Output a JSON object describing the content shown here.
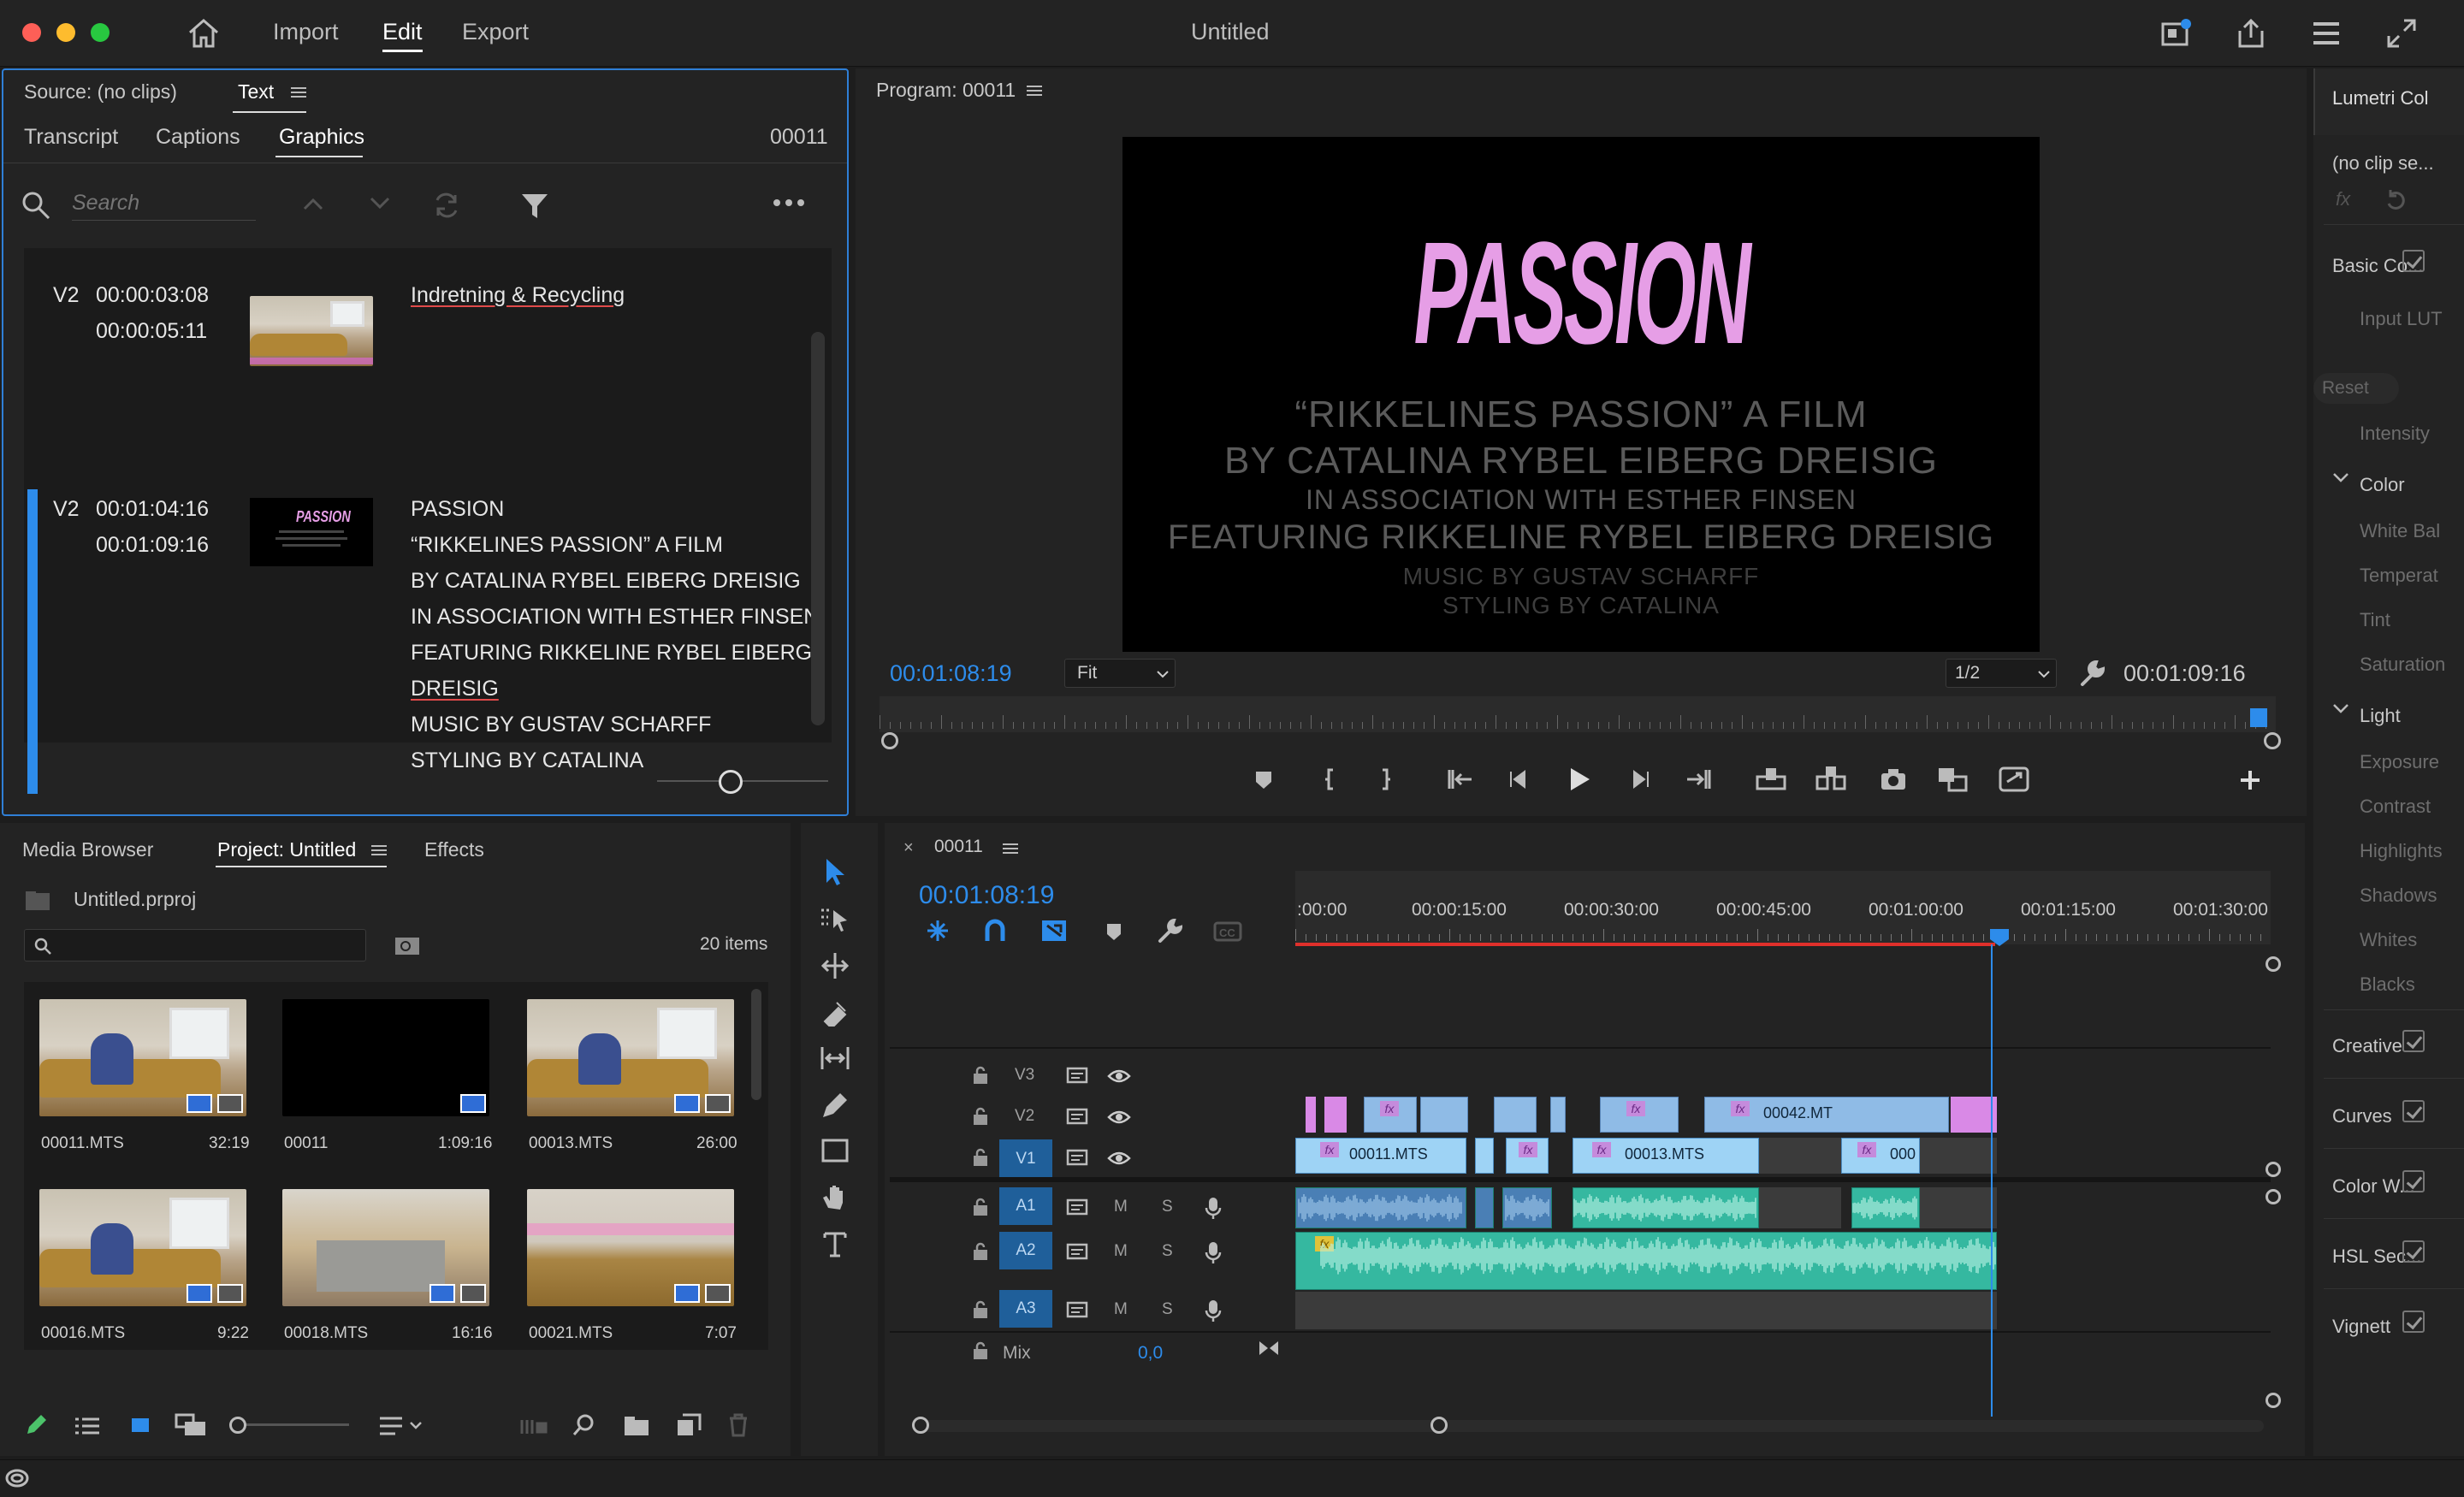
{
  "app": {
    "window_title": "Untitled",
    "menu": [
      "Import",
      "Edit",
      "Export"
    ],
    "active_menu": "Edit"
  },
  "source_panel": {
    "source_label": "Source: (no clips)",
    "text_tab": "Text",
    "subtabs": [
      "Transcript",
      "Captions",
      "Graphics"
    ],
    "active_subtab": "Graphics",
    "sequence_name": "00011",
    "search_placeholder": "Search",
    "graphics_items": [
      {
        "track": "V2",
        "in": "00:00:03:08",
        "out": "00:00:05:11",
        "lines": [
          "Indretning & Recycling"
        ]
      },
      {
        "track": "V2",
        "in": "00:01:04:16",
        "out": "00:01:09:16",
        "lines": [
          "PASSION",
          "“RIKKELINES PASSION” A FILM",
          "BY CATALINA RYBEL EIBERG DREISIG",
          "IN ASSOCIATION WITH ESTHER FINSEN",
          "FEATURING RIKKELINE RYBEL EIBERG",
          "DREISIG",
          "MUSIC BY GUSTAV SCHARFF",
          "STYLING BY CATALINA"
        ]
      }
    ],
    "thumb_title_text": "PASSION"
  },
  "program_monitor": {
    "label": "Program: 00011",
    "title_text": "PASSION",
    "credits": [
      "“RIKKELINES PASSION” A FILM",
      "BY CATALINA RYBEL EIBERG DREISIG",
      "IN ASSOCIATION WITH ESTHER FINSEN",
      "FEATURING RIKKELINE RYBEL EIBERG DREISIG",
      "MUSIC BY GUSTAV SCHARFF",
      "STYLING BY CATALINA"
    ],
    "current_time": "00:01:08:19",
    "zoom": "Fit",
    "resolution": "1/2",
    "duration": "00:01:09:16",
    "playhead_fraction": 0.988
  },
  "project_panel": {
    "tabs": [
      "Media Browser",
      "Project: Untitled",
      "Effects"
    ],
    "active_tab": "Project: Untitled",
    "project_file": "Untitled.prproj",
    "item_count": "20 items",
    "items": [
      {
        "name": "00011.MTS",
        "duration": "32:19",
        "kind": "video"
      },
      {
        "name": "00011",
        "duration": "1:09:16",
        "kind": "sequence"
      },
      {
        "name": "00013.MTS",
        "duration": "26:00",
        "kind": "video"
      },
      {
        "name": "00016.MTS",
        "duration": "9:22",
        "kind": "video"
      },
      {
        "name": "00018.MTS",
        "duration": "16:16",
        "kind": "video"
      },
      {
        "name": "00021.MTS",
        "duration": "7:07",
        "kind": "video"
      }
    ]
  },
  "timeline": {
    "sequence_tab": "00011",
    "current_time": "00:01:08:19",
    "ruler_labels": [
      ":00:00",
      "00:00:15:00",
      "00:00:30:00",
      "00:00:45:00",
      "00:01:00:00",
      "00:01:15:00",
      "00:01:30:00"
    ],
    "video_tracks": [
      "V3",
      "V2",
      "V1"
    ],
    "audio_tracks": [
      "A1",
      "A2",
      "A3"
    ],
    "mix_label": "Mix",
    "mix_value": "0,0",
    "track_buttons": {
      "mute": "M",
      "solo": "S"
    },
    "clips": {
      "v2_named": "00042.MT",
      "v1_a": "00011.MTS",
      "v1_b": "00013.MTS",
      "v1_c": "000"
    }
  },
  "lumetri": {
    "title": "Lumetri Col",
    "clip": "(no clip se...",
    "sections": [
      {
        "label": "Basic Co...",
        "enabled": true
      },
      {
        "label": "Input LUT",
        "dim": true
      },
      {
        "label": "Reset",
        "dim": true
      },
      {
        "label": "Intensity",
        "dim": true
      },
      {
        "label": "Color",
        "expanded": true
      },
      {
        "label": "White Bal",
        "dim": true
      },
      {
        "label": "Temperat",
        "dim": true
      },
      {
        "label": "Tint",
        "dim": true
      },
      {
        "label": "Saturation",
        "dim": true
      },
      {
        "label": "Light",
        "expanded": true
      },
      {
        "label": "Exposure",
        "dim": true
      },
      {
        "label": "Contrast",
        "dim": true
      },
      {
        "label": "Highlights",
        "dim": true
      },
      {
        "label": "Shadows",
        "dim": true
      },
      {
        "label": "Whites",
        "dim": true
      },
      {
        "label": "Blacks",
        "dim": true
      },
      {
        "label": "Creative",
        "enabled": true
      },
      {
        "label": "Curves",
        "enabled": true
      },
      {
        "label": "Color W...",
        "enabled": true
      },
      {
        "label": "HSL Sec...",
        "enabled": true
      },
      {
        "label": "Vignett",
        "enabled": true
      }
    ]
  },
  "colors": {
    "accent_blue": "#2d8ceb",
    "title_pink": "#e69ee6",
    "audio_teal": "#35b8a0",
    "video_clip": "#8fbbe6",
    "graphic_clip": "#d989e6",
    "playhead": "#2d8ceb",
    "render_bar_red": "#e0302b"
  }
}
